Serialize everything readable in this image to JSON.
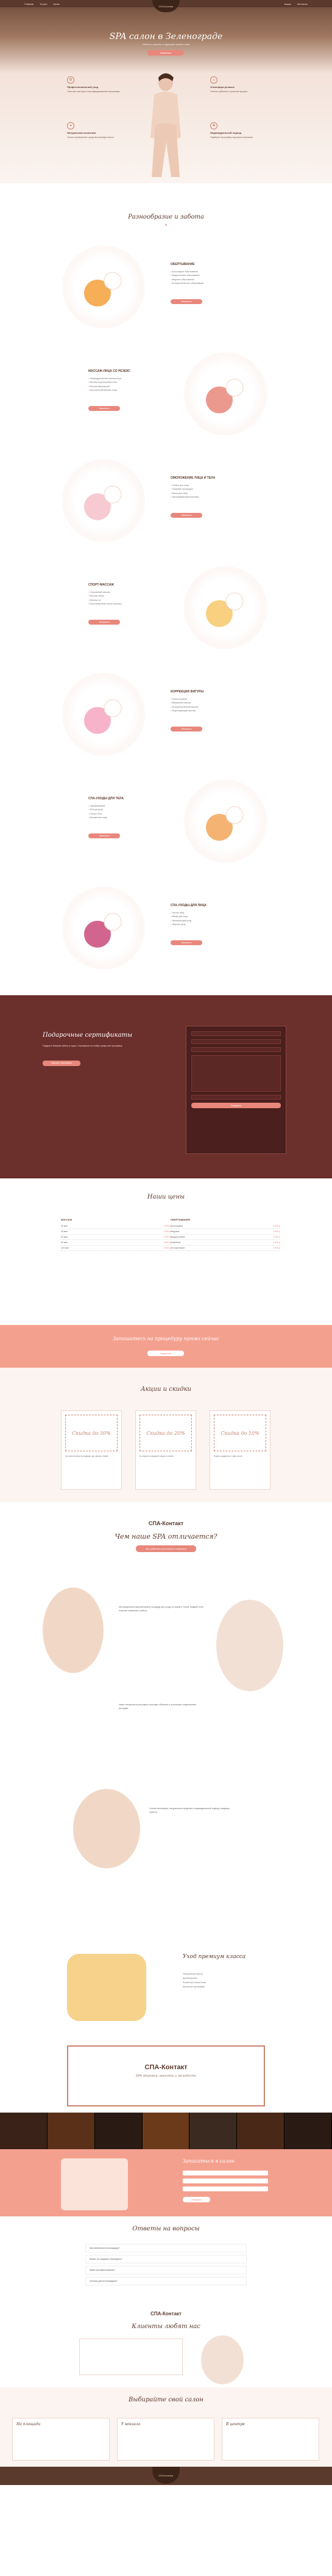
{
  "header": {
    "logo": "СПА-Контакт",
    "nav": [
      "Главная",
      "Услуги",
      "Цены",
      "Акции",
      "Контакты"
    ]
  },
  "hero": {
    "title": "SPA салон в Зеленограде",
    "subtitle": "Забота о красоте и здоровье вашего тела",
    "button": "Записаться",
    "features": [
      {
        "icon": "lotus-icon",
        "title": "Профессиональный уход",
        "text": "Опытные мастера и сертифицированные программы"
      },
      {
        "icon": "stones-icon",
        "title": "Натуральная косметика",
        "text": "Только проверенные средства премиум класса"
      },
      {
        "icon": "candle-icon",
        "title": "Атмосфера релакса",
        "text": "Уютные кабинеты и приятная музыка"
      },
      {
        "icon": "massage-icon",
        "title": "Индивидуальный подход",
        "text": "Подберем программу под ваши пожелания"
      }
    ]
  },
  "services": {
    "title": "Разнообразие и забота",
    "button": "Записаться",
    "items": [
      {
        "name": "ОБЕРТЫВАНИЕ",
        "list": [
          "Шоколадное обертывание",
          "Водорослевое обертывание",
          "Медовое обертывание",
          "Антицеллюлитное обертывание"
        ]
      },
      {
        "name": "МАССАЖ-ЛИЦА СО РЕЗЕКС",
        "list": [
          "Лимфодренажный массаж лица",
          "Массаж воротниковой зоны",
          "Массаж буккальный",
          "Классический массаж лица"
        ]
      },
      {
        "name": "ОМОЛОЖЕНИЕ ЛИЦА И ТЕЛА",
        "list": [
          "Пилинг для лица",
          "Уходовые процедуры",
          "Маска для лица",
          "Омолаживающий комплекс"
        ]
      },
      {
        "name": "СПОРТ-МАССАЖ",
        "list": [
          "Спортивный массаж",
          "Массаж спины",
          "Массаж ног",
          "Восстановление после нагрузок"
        ]
      },
      {
        "name": "КОРРЕКЦИЯ ФИГУРЫ",
        "list": [
          "Прессотерапия",
          "Вакуумный массаж",
          "Антицеллюлитный массаж",
          "Моделирующий массаж"
        ]
      },
      {
        "name": "СПА-УХОДЫ ДЛЯ ТЕЛА",
        "list": [
          "Скрабирование",
          "SPA-ритуалы",
          "Пилинг тела",
          "Увлажнение кожи"
        ]
      },
      {
        "name": "СПА-УХОДЫ ДЛЯ ЛИЦА",
        "list": [
          "Чистка лица",
          "Маски для лица",
          "Увлажняющий уход",
          "Лифтинг уход"
        ]
      }
    ]
  },
  "gift": {
    "title": "Подарочные сертификаты",
    "text": "Подарите близким заботу и отдых. Сертификат на любую сумму или программу.",
    "button": "Заказать сертификат",
    "form_button": "Отправить"
  },
  "prices": {
    "title": "Наши цены",
    "left_head": "МАССАЖ",
    "right_head": "ОБЕРТЫВАНИЯ",
    "left_rows": [
      [
        "30 мин",
        "1 000 р"
      ],
      [
        "45 мин",
        "1 500 р"
      ],
      [
        "60 мин",
        "2 000 р"
      ],
      [
        "90 мин",
        "2 800 р"
      ],
      [
        "120 мин",
        "3 500 р"
      ]
    ],
    "right_rows": [
      [
        "Шоколадное",
        "2 000 р"
      ],
      [
        "Медовое",
        "1 800 р"
      ],
      [
        "Водорослевое",
        "2 200 р"
      ],
      [
        "Кофейное",
        "1 900 р"
      ],
      [
        "Антицеллюлит",
        "2 500 р"
      ]
    ]
  },
  "band": {
    "text": "Запишитесь на процедуру прямо сейчас",
    "button": "Записаться"
  },
  "discounts": {
    "title": "Акции и скидки",
    "items": [
      {
        "head": "Скидка до 30%",
        "text": "На комплексные программы при записи онлайн"
      },
      {
        "head": "Скидка до 20%",
        "text": "На первое посещение нашего салона"
      },
      {
        "head": "Скидка до 10%",
        "text": "В день рождения и 3 дня после"
      }
    ]
  },
  "about": {
    "logo": "СПА-Контакт",
    "question": "Чем наше SPA отличается?",
    "pill": "Мы работаем для вашего комфорта",
    "p1": "Мы предлагаем широкий выбор процедур для ухода за лицом и телом. Каждый гость получает внимание и заботу.",
    "p2": "Наши специалисты регулярно проходят обучение и используют современные методики.",
    "p3": "Уютная атмосфера, натуральные средства и индивидуальный подход к каждому клиенту."
  },
  "care": {
    "title": "Уход премиум класса",
    "list": [
      "Натуральные масла",
      "Ароматерапия",
      "Косметика класса люкс",
      "Авторские программы"
    ]
  },
  "cert": {
    "title": "СПА-Контакт",
    "subtitle": "SPA здоровья, красоты и молодости"
  },
  "booking": {
    "title": "Записаться в салон",
    "button": "Отправить"
  },
  "faq": {
    "title": "Ответы на вопросы",
    "items": [
      "Как записаться на процедуру?",
      "Можно ли подарить сертификат?",
      "Какие противопоказания?",
      "Сколько длится процедура?"
    ]
  },
  "reviews": {
    "logo": "СПА-Контакт",
    "title": "Клиенты любят нас"
  },
  "map": {
    "title": "Выбирайте свой салон",
    "salons": [
      "На площади",
      "У вокзала",
      "В центре"
    ]
  },
  "footer": {
    "logo": "СПА-Контакт"
  },
  "colors": {
    "accent": "#e8877b",
    "brown": "#5a3a2d",
    "wine": "#6b2f2c"
  }
}
